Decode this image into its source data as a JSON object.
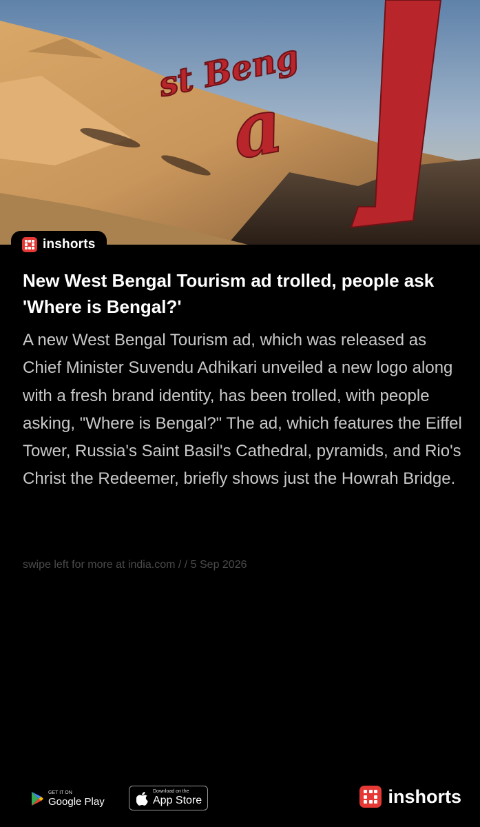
{
  "brand": {
    "name": "inshorts",
    "accent_color": "#e53935"
  },
  "hero": {
    "image_text": "st Bengal",
    "icon": "news-photo"
  },
  "article": {
    "headline": "New West Bengal Tourism ad trolled, people ask 'Where is Bengal?'",
    "body": "A new West Bengal Tourism ad, which was released as Chief Minister Suvendu Adhikari unveiled a new logo along with a fresh brand identity, has been trolled, with people asking, \"Where is Bengal?\" The ad, which features the Eiffel Tower, Russia's Saint Basil's Cathedral, pyramids, and Rio's Christ the Redeemer, briefly shows just the Howrah Bridge.",
    "meta": "swipe left for more at india.com /  / 5 Sep 2026"
  },
  "footer": {
    "google_play": {
      "small": "GET IT ON",
      "big": "Google Play",
      "icon": "play-store-icon"
    },
    "app_store": {
      "small": "Download on the",
      "big": "App Store",
      "icon": "apple-icon"
    },
    "brand_name": "inshorts"
  }
}
